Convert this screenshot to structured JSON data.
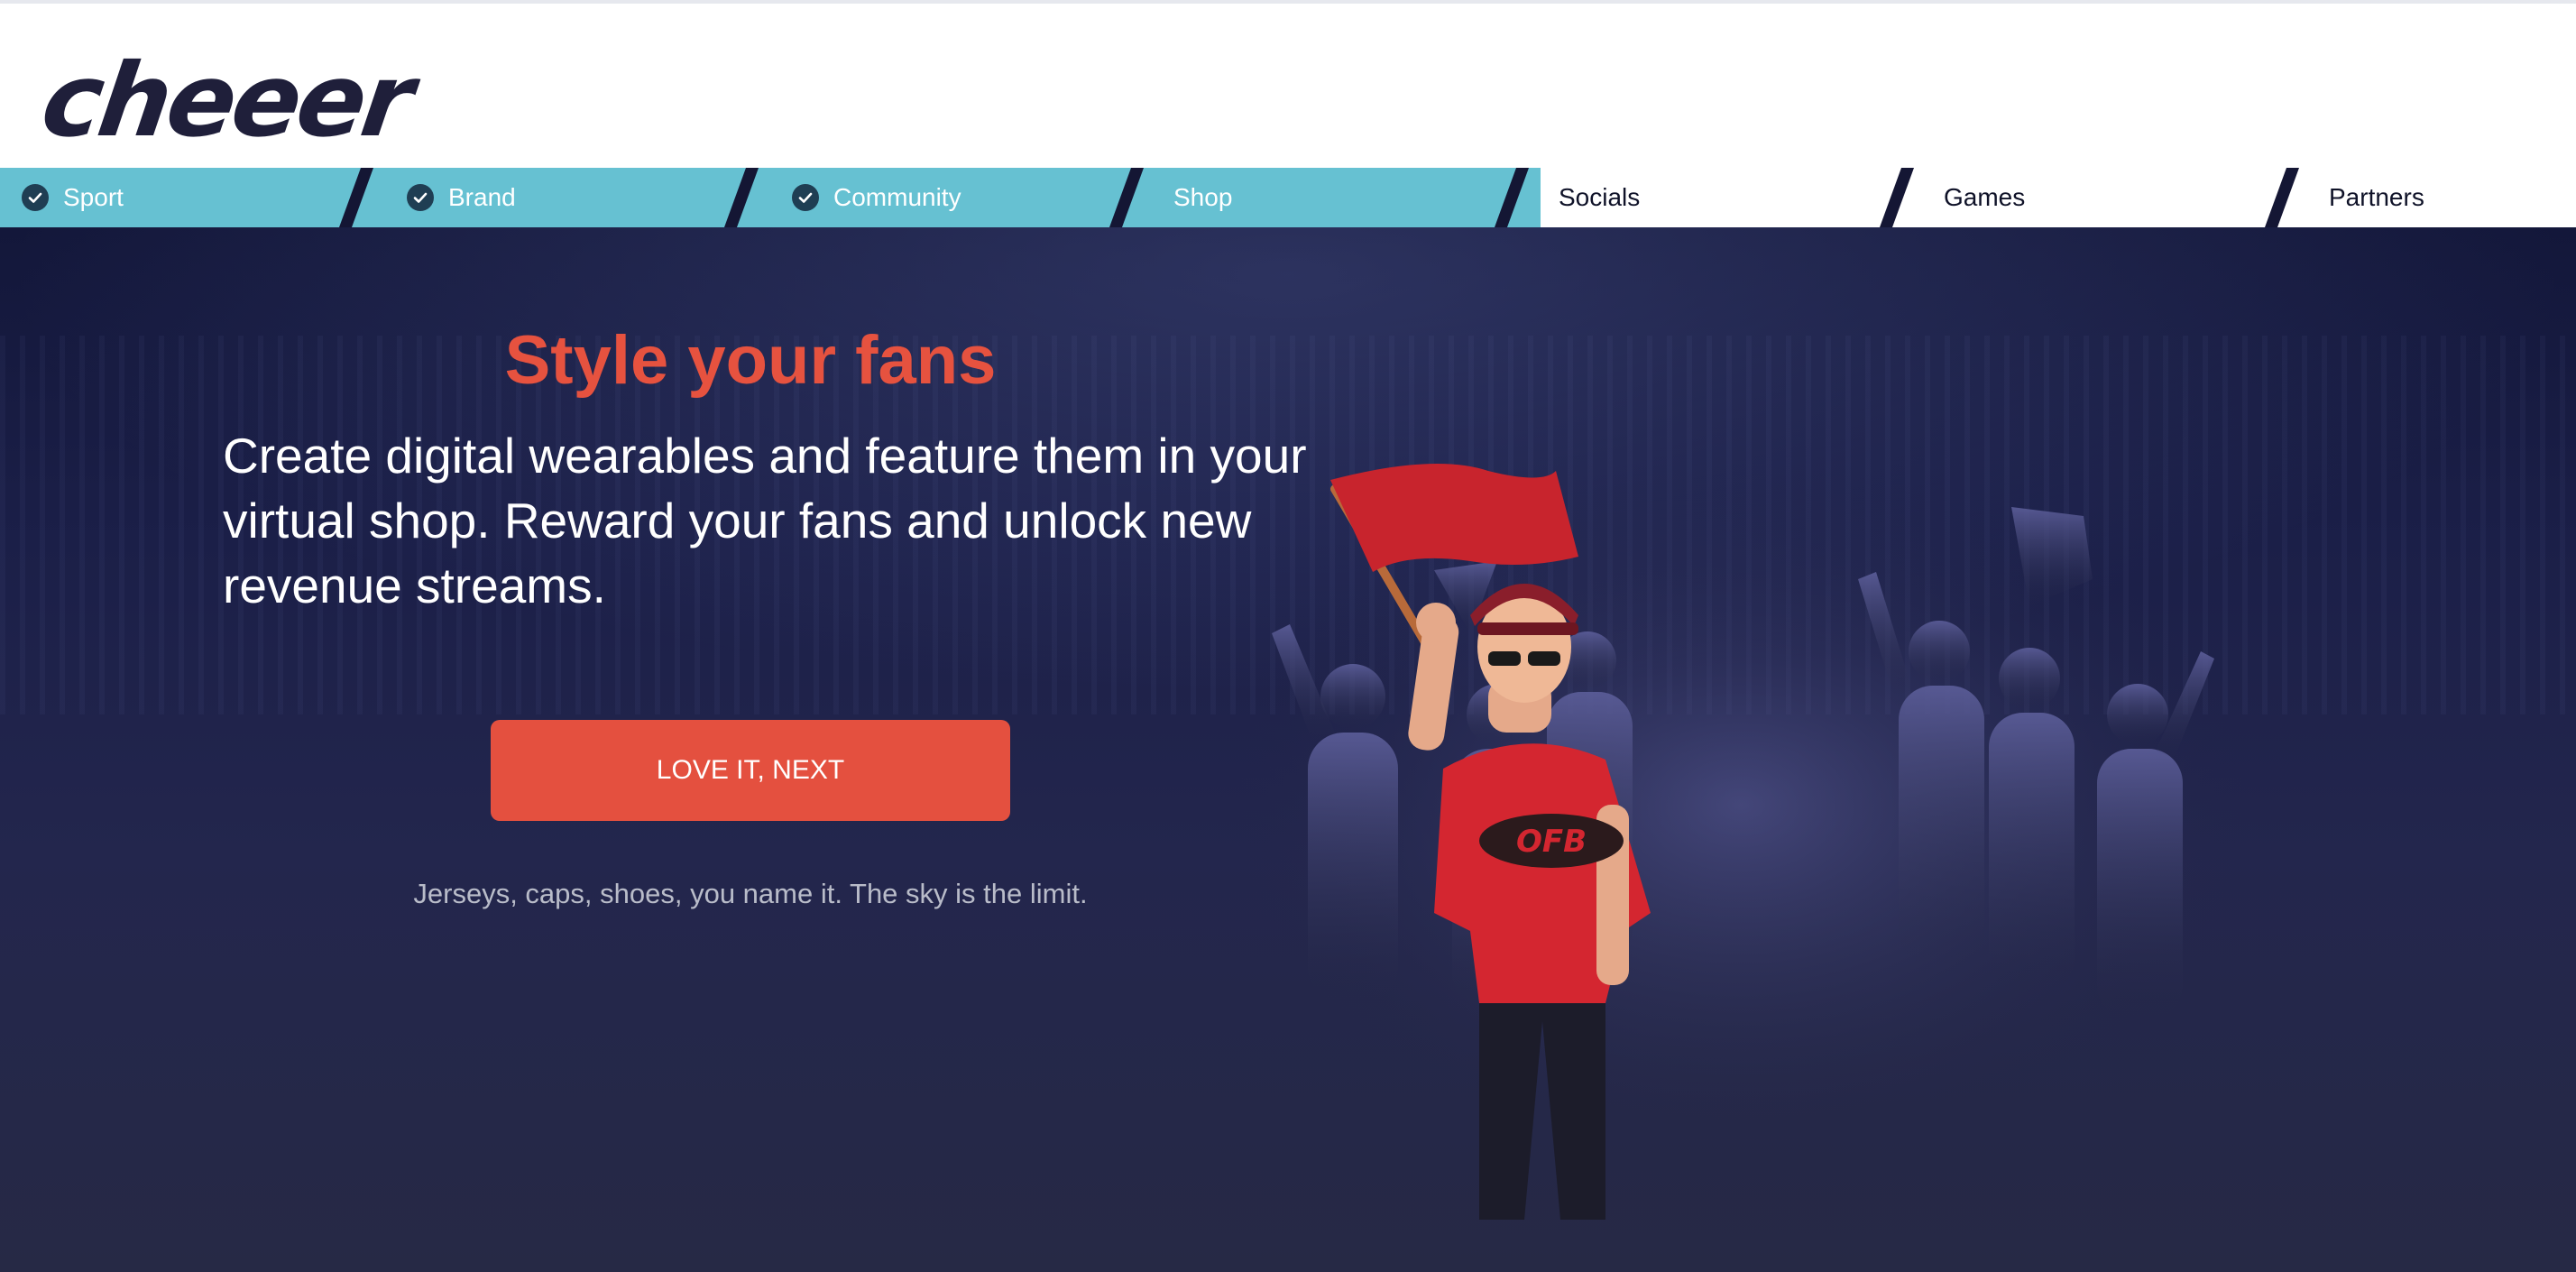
{
  "brand": {
    "logo_text": "cheeer"
  },
  "steps": [
    {
      "label": "Sport",
      "status": "done"
    },
    {
      "label": "Brand",
      "status": "done"
    },
    {
      "label": "Community",
      "status": "done"
    },
    {
      "label": "Shop",
      "status": "current"
    },
    {
      "label": "Socials",
      "status": "todo"
    },
    {
      "label": "Games",
      "status": "todo"
    },
    {
      "label": "Partners",
      "status": "todo"
    }
  ],
  "hero": {
    "title": "Style your fans",
    "description": "Create digital wearables and feature them in your virtual shop. Reward your fans and unlock new revenue streams.",
    "cta_label": "LOVE IT, NEXT",
    "note": "Jerseys, caps, shoes, you name it. The sky is the limit.",
    "shirt_text": "OFB"
  },
  "colors": {
    "accent": "#e4503f",
    "step_done": "#66c1d2",
    "hero_bg": "#1b1f48",
    "logo": "#1f1f3a"
  },
  "icons": [
    "check-icon"
  ]
}
